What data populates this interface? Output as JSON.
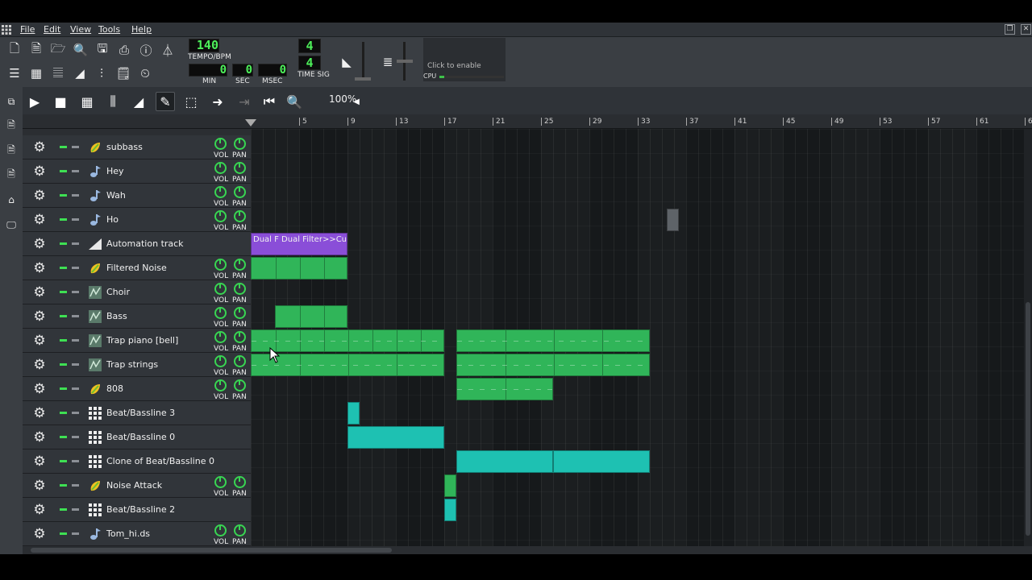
{
  "menu": {
    "items": [
      "File",
      "Edit",
      "View",
      "Tools",
      "Help"
    ]
  },
  "toolbar": {
    "tempo": "140",
    "tempo_label": "TEMPO/BPM",
    "min_value": "0",
    "sec_value": "0",
    "msec_value": "0",
    "min_label": "MIN",
    "sec_label": "SEC",
    "msec_label": "MSEC",
    "timesig_num": "4",
    "timesig_den": "4",
    "timesig_label": "TIME SIG",
    "cpu_hint": "Click to enable",
    "cpu_label": "CPU",
    "cpu_level_fraction": 0.07
  },
  "song_editor": {
    "zoom": "100%",
    "ruler_ticks": [
      "5",
      "9",
      "13",
      "17",
      "21",
      "25",
      "29",
      "33",
      "37",
      "41",
      "45",
      "49",
      "53",
      "57",
      "61",
      "6"
    ]
  },
  "knob_labels": {
    "vol": "VOL",
    "pan": "PAN"
  },
  "tracks": [
    {
      "name": "subbass",
      "icon": "fruit-icon",
      "knobs": true
    },
    {
      "name": "Hey",
      "icon": "note-icon",
      "knobs": true
    },
    {
      "name": "Wah",
      "icon": "note-icon",
      "knobs": true
    },
    {
      "name": "Ho",
      "icon": "note-icon",
      "knobs": true
    },
    {
      "name": "Automation track",
      "icon": "ramp-icon",
      "knobs": false
    },
    {
      "name": "Filtered Noise",
      "icon": "fruit-icon",
      "knobs": true
    },
    {
      "name": "Choir",
      "icon": "synth-icon",
      "knobs": true
    },
    {
      "name": "Bass",
      "icon": "synth-icon",
      "knobs": true
    },
    {
      "name": "Trap piano [bell]",
      "icon": "synth-icon",
      "knobs": true
    },
    {
      "name": "Trap strings",
      "icon": "synth-icon",
      "knobs": true
    },
    {
      "name": "808",
      "icon": "fruit-icon",
      "knobs": true
    },
    {
      "name": "Beat/Bassline 3",
      "icon": "beat-icon",
      "knobs": false
    },
    {
      "name": "Beat/Bassline 0",
      "icon": "beat-icon",
      "knobs": false
    },
    {
      "name": "Clone of Beat/Bassline 0",
      "icon": "beat-icon",
      "knobs": false
    },
    {
      "name": "Noise Attack",
      "icon": "fruit-icon",
      "knobs": true
    },
    {
      "name": "Beat/Bassline 2",
      "icon": "beat-icon",
      "knobs": false
    },
    {
      "name": "Tom_hi.ds",
      "icon": "note-icon",
      "knobs": true
    }
  ],
  "automation_clip_label": "Dual F Dual Filter>>Cutoff",
  "colors": {
    "instrument_clip": "#30b559",
    "beat_clip": "#1ec1b2",
    "automation_clip": "#8a4ed8",
    "lcd_text": "#4df05a"
  }
}
